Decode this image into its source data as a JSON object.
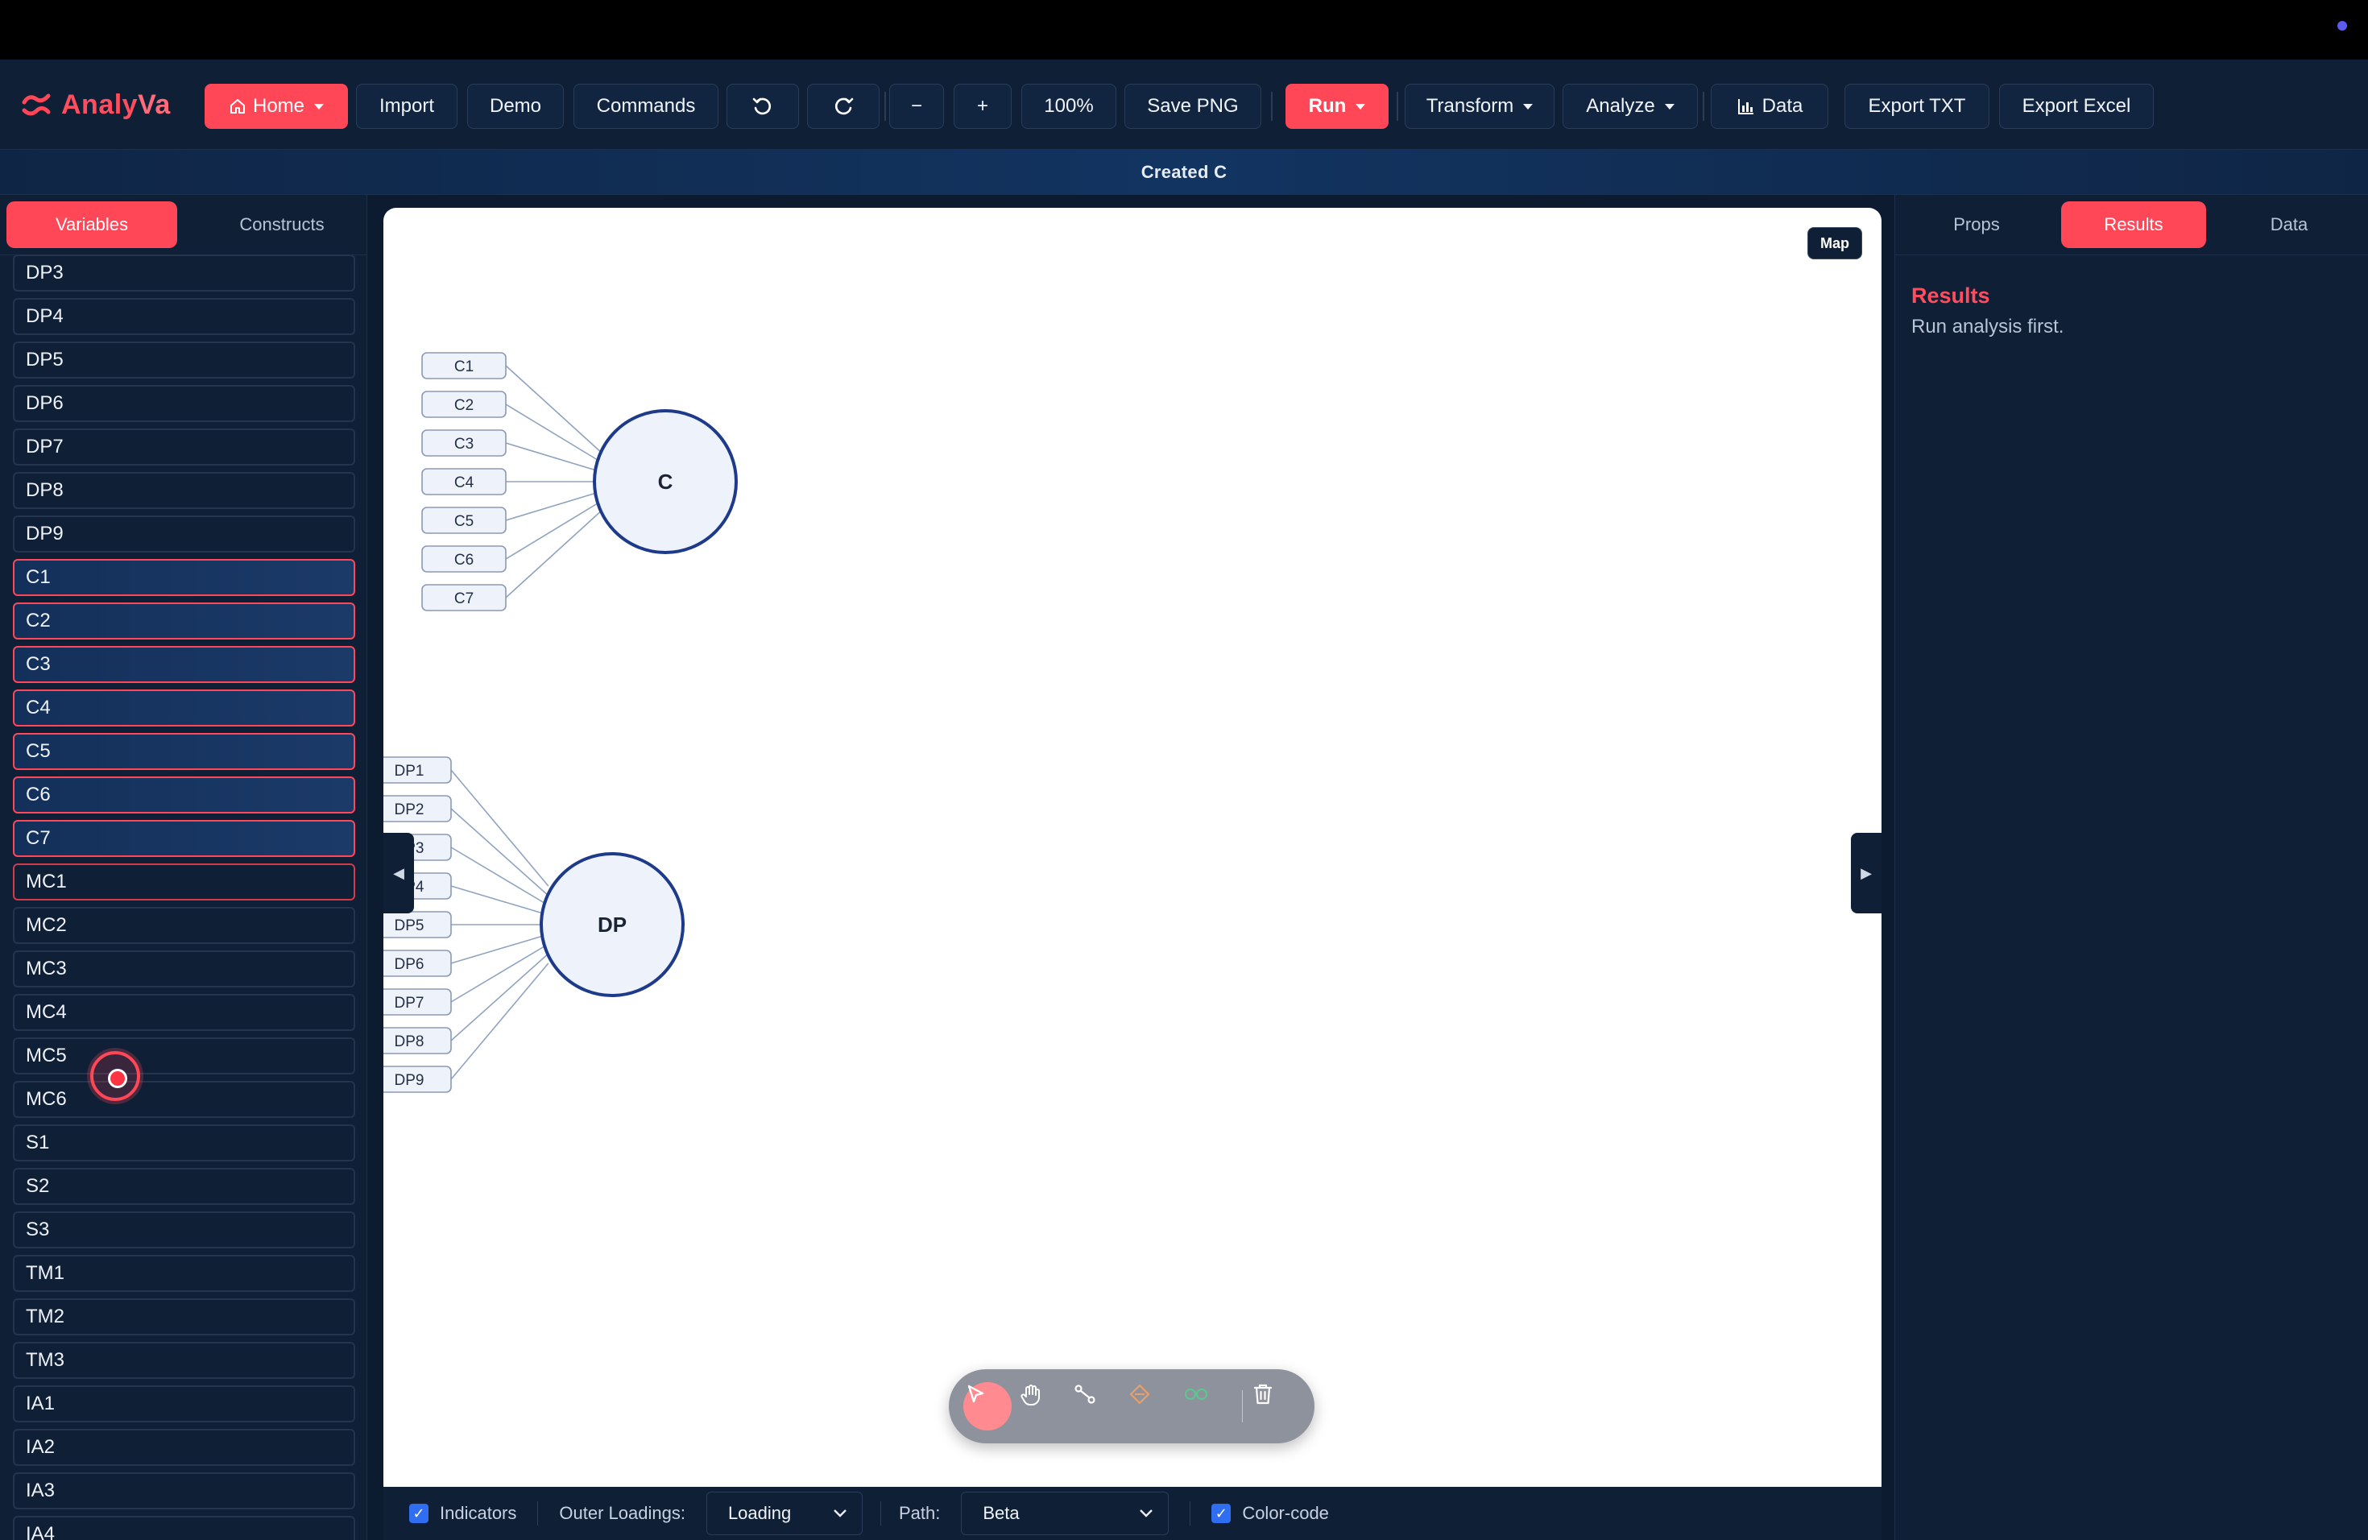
{
  "app": {
    "name_part1": "Analy",
    "name_part2": "Va"
  },
  "toolbar": {
    "home": "Home",
    "import": "Import",
    "demo": "Demo",
    "commands": "Commands",
    "zoom_out": "−",
    "zoom_in": "+",
    "zoom_level": "100%",
    "save_png": "Save PNG",
    "run": "Run",
    "transform": "Transform",
    "analyze": "Analyze",
    "data": "Data",
    "export_txt": "Export TXT",
    "export_excel": "Export Excel"
  },
  "status": {
    "message": "Created C"
  },
  "left_panel": {
    "tabs": [
      "Variables",
      "Constructs"
    ],
    "active_tab": "Variables",
    "variables": [
      "DP3",
      "DP4",
      "DP5",
      "DP6",
      "DP7",
      "DP8",
      "DP9",
      "C1",
      "C2",
      "C3",
      "C4",
      "C5",
      "C6",
      "C7",
      "MC1",
      "MC2",
      "MC3",
      "MC4",
      "MC5",
      "MC6",
      "S1",
      "S2",
      "S3",
      "TM1",
      "TM2",
      "TM3",
      "IA1",
      "IA2",
      "IA3",
      "IA4"
    ],
    "selected": [
      "C1",
      "C2",
      "C3",
      "C4",
      "C5",
      "C6",
      "C7"
    ],
    "hovered": "MC1"
  },
  "canvas": {
    "map_button": "Map",
    "constructs": [
      {
        "name": "C",
        "indicators": [
          "C1",
          "C2",
          "C3",
          "C4",
          "C5",
          "C6",
          "C7"
        ]
      },
      {
        "name": "DP",
        "indicators": [
          "DP1",
          "DP2",
          "DP3",
          "DP4",
          "DP5",
          "DP6",
          "DP7",
          "DP8",
          "DP9"
        ]
      }
    ],
    "left_handle": "◀",
    "right_handle": "▶"
  },
  "floating_tools": [
    "select-icon",
    "hand-icon",
    "connect-icon",
    "moderator-icon",
    "mediator-icon",
    "trash-icon"
  ],
  "bottom_bar": {
    "indicators_label": "Indicators",
    "indicators_checked": true,
    "outer_loadings_label": "Outer Loadings:",
    "outer_loadings_value": "Loading",
    "path_label": "Path:",
    "path_value": "Beta",
    "color_code_label": "Color-code",
    "color_code_checked": true
  },
  "right_panel": {
    "tabs": [
      "Props",
      "Results",
      "Data"
    ],
    "active_tab": "Results",
    "results_title": "Results",
    "results_message": "Run analysis first."
  },
  "colors": {
    "accent": "#ff4757",
    "panel": "#0f1f36",
    "node_stroke": "#1e3a8a",
    "node_fill": "#eef3fb"
  }
}
